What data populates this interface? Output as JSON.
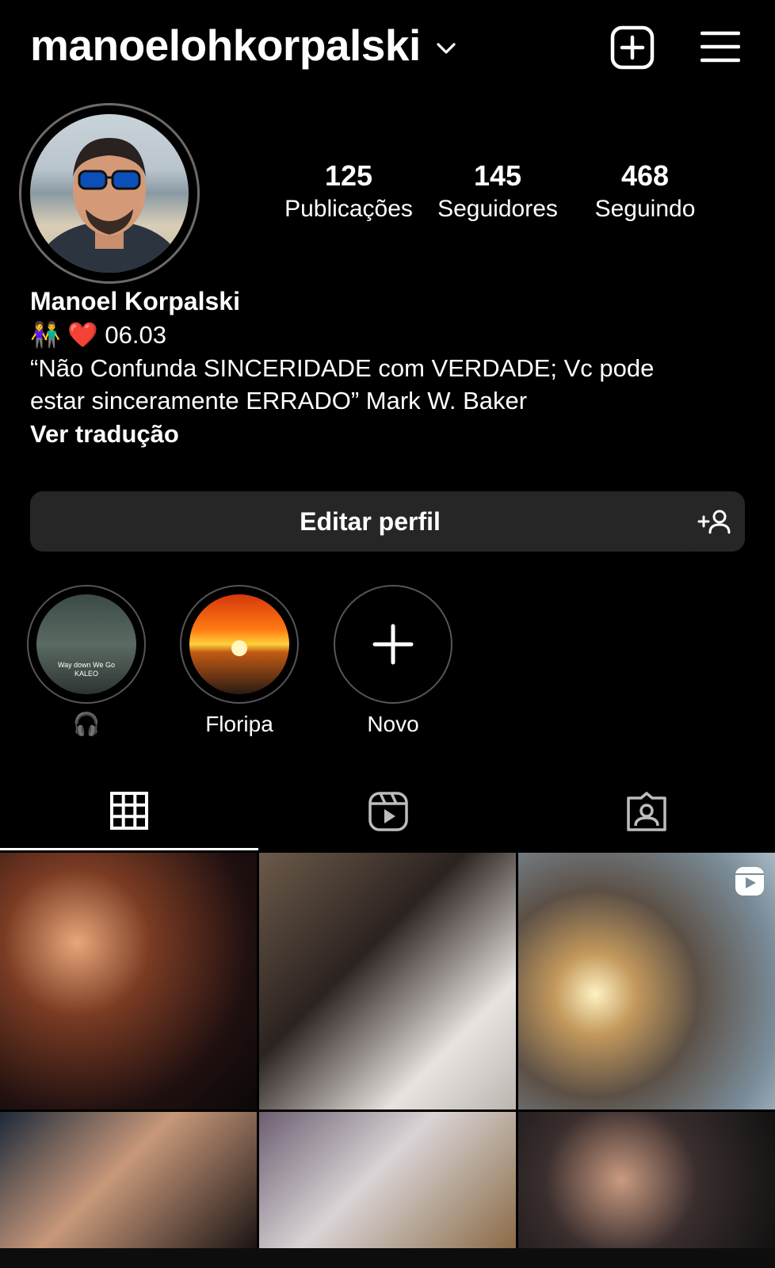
{
  "header": {
    "username": "manoelohkorpalski"
  },
  "profile": {
    "stats": [
      {
        "value": "125",
        "label": "Publicações"
      },
      {
        "value": "145",
        "label": "Seguidores"
      },
      {
        "value": "468",
        "label": "Seguindo"
      }
    ],
    "name": "Manoel Korpalski",
    "bio_line1": "👫 ❤️ 06.03",
    "bio_line2": "“Não Confunda SINCERIDADE com VERDADE; Vc pode",
    "bio_line3": "estar sinceramente ERRADO” Mark W. Baker",
    "translate_label": "Ver tradução"
  },
  "actions": {
    "edit_profile_label": "Editar perfil"
  },
  "highlights": [
    {
      "label": "🎧",
      "cover_caption_1": "Way down We Go",
      "cover_caption_2": "KALEO"
    },
    {
      "label": "Floripa"
    },
    {
      "label": "Novo"
    }
  ],
  "colors": {
    "background": "#000000",
    "button_bg": "#262626",
    "text": "#ffffff"
  },
  "icons": {
    "tabs": [
      "grid-icon",
      "reels-icon",
      "tagged-icon"
    ]
  }
}
